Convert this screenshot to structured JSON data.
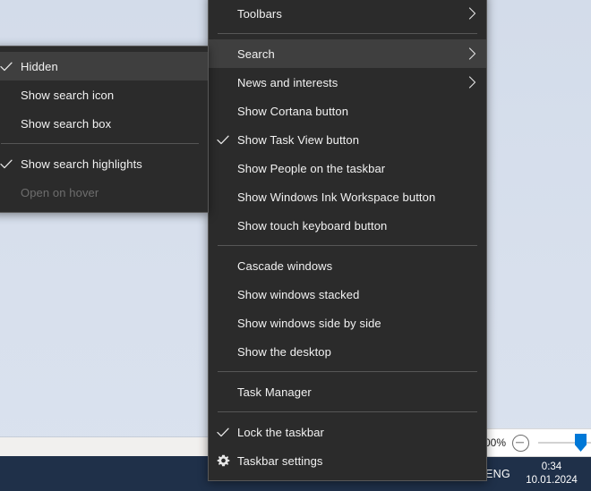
{
  "desktop": {
    "background_color": "#d5deec",
    "window_strip_color": "#f1f0ee"
  },
  "taskbar": {
    "background_color": "#1f3049",
    "tray": {
      "network_icon": "network-icon",
      "volume_icon": "volume-icon",
      "language": "ENG",
      "clock_time": "0:34",
      "clock_date": "10.01.2024"
    }
  },
  "volume_flyout": {
    "percent_label": "00%",
    "mute_icon": "mute-icon",
    "slider_value": 100
  },
  "context_menu": {
    "accent_highlight": "#3f3f3f",
    "background": "#2b2b2b",
    "items": [
      {
        "label": "Toolbars",
        "check": false,
        "submenu": true,
        "disabled": false,
        "highlight": false
      },
      {
        "separator": true
      },
      {
        "label": "Search",
        "check": false,
        "submenu": true,
        "disabled": false,
        "highlight": true
      },
      {
        "label": "News and interests",
        "check": false,
        "submenu": true,
        "disabled": false,
        "highlight": false
      },
      {
        "label": "Show Cortana button",
        "check": false,
        "submenu": false,
        "disabled": false,
        "highlight": false
      },
      {
        "label": "Show Task View button",
        "check": true,
        "submenu": false,
        "disabled": false,
        "highlight": false
      },
      {
        "label": "Show People on the taskbar",
        "check": false,
        "submenu": false,
        "disabled": false,
        "highlight": false
      },
      {
        "label": "Show Windows Ink Workspace button",
        "check": false,
        "submenu": false,
        "disabled": false,
        "highlight": false
      },
      {
        "label": "Show touch keyboard button",
        "check": false,
        "submenu": false,
        "disabled": false,
        "highlight": false
      },
      {
        "separator": true
      },
      {
        "label": "Cascade windows",
        "check": false,
        "submenu": false,
        "disabled": false,
        "highlight": false
      },
      {
        "label": "Show windows stacked",
        "check": false,
        "submenu": false,
        "disabled": false,
        "highlight": false
      },
      {
        "label": "Show windows side by side",
        "check": false,
        "submenu": false,
        "disabled": false,
        "highlight": false
      },
      {
        "label": "Show the desktop",
        "check": false,
        "submenu": false,
        "disabled": false,
        "highlight": false
      },
      {
        "separator": true
      },
      {
        "label": "Task Manager",
        "check": false,
        "submenu": false,
        "disabled": false,
        "highlight": false
      },
      {
        "separator": true
      },
      {
        "label": "Lock the taskbar",
        "check": true,
        "submenu": false,
        "disabled": false,
        "highlight": false
      },
      {
        "label": "Taskbar settings",
        "check": false,
        "submenu": false,
        "disabled": false,
        "highlight": false,
        "icon": "gear-icon"
      }
    ]
  },
  "search_submenu": {
    "items": [
      {
        "label": "Hidden",
        "check": true,
        "disabled": false,
        "highlight": true
      },
      {
        "label": "Show search icon",
        "check": false,
        "disabled": false,
        "highlight": false
      },
      {
        "label": "Show search box",
        "check": false,
        "disabled": false,
        "highlight": false
      },
      {
        "separator": true
      },
      {
        "label": "Show search highlights",
        "check": true,
        "disabled": false,
        "highlight": false
      },
      {
        "label": "Open on hover",
        "check": false,
        "disabled": true,
        "highlight": false
      }
    ]
  }
}
